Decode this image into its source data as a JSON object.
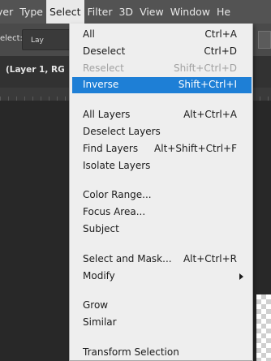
{
  "menubar": [
    "yer",
    "Type",
    "Select",
    "Filter",
    "3D",
    "View",
    "Window",
    "He"
  ],
  "options_bar": {
    "label": "elect:",
    "dropdown_value": "Lay"
  },
  "document_tab": {
    "title": "(Layer 1, RG"
  },
  "select_menu": {
    "items": [
      {
        "label": "All",
        "shortcut": "Ctrl+A",
        "state": "normal"
      },
      {
        "label": "Deselect",
        "shortcut": "Ctrl+D",
        "state": "normal"
      },
      {
        "label": "Reselect",
        "shortcut": "Shift+Ctrl+D",
        "state": "disabled"
      },
      {
        "label": "Inverse",
        "shortcut": "Shift+Ctrl+I",
        "state": "highlighted"
      },
      {
        "label": "All Layers",
        "shortcut": "Alt+Ctrl+A",
        "state": "normal"
      },
      {
        "label": "Deselect Layers",
        "shortcut": "",
        "state": "normal"
      },
      {
        "label": "Find Layers",
        "shortcut": "Alt+Shift+Ctrl+F",
        "state": "normal"
      },
      {
        "label": "Isolate Layers",
        "shortcut": "",
        "state": "normal"
      },
      {
        "label": "Color Range...",
        "shortcut": "",
        "state": "normal"
      },
      {
        "label": "Focus Area...",
        "shortcut": "",
        "state": "normal"
      },
      {
        "label": "Subject",
        "shortcut": "",
        "state": "normal"
      },
      {
        "label": "Select and Mask...",
        "shortcut": "Alt+Ctrl+R",
        "state": "normal"
      },
      {
        "label": "Modify",
        "shortcut": "",
        "state": "submenu"
      },
      {
        "label": "Grow",
        "shortcut": "",
        "state": "normal"
      },
      {
        "label": "Similar",
        "shortcut": "",
        "state": "normal"
      },
      {
        "label": "Transform Selection",
        "shortcut": "",
        "state": "normal"
      }
    ]
  },
  "colors": {
    "highlight": "#1e7fd6",
    "menu_bg": "#eeeeee",
    "menubar_bg": "#535353"
  }
}
